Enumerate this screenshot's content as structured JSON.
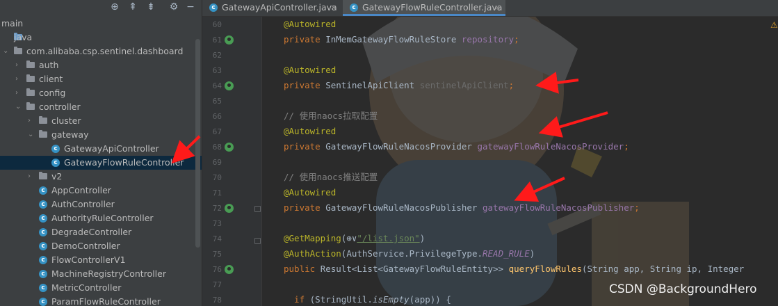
{
  "project": {
    "tree": [
      {
        "label": "main",
        "indent": 0,
        "type": "none",
        "arrow": ""
      },
      {
        "label": "java",
        "indent": 1,
        "type": "src",
        "arrow": ""
      },
      {
        "label": "com.alibaba.csp.sentinel.dashboard",
        "indent": 1,
        "type": "folder",
        "arrow": "v"
      },
      {
        "label": "auth",
        "indent": 2,
        "type": "folder",
        "arrow": ">"
      },
      {
        "label": "client",
        "indent": 2,
        "type": "folder",
        "arrow": ">"
      },
      {
        "label": "config",
        "indent": 2,
        "type": "folder",
        "arrow": ">"
      },
      {
        "label": "controller",
        "indent": 2,
        "type": "folder",
        "arrow": "v"
      },
      {
        "label": "cluster",
        "indent": 3,
        "type": "folder",
        "arrow": ">"
      },
      {
        "label": "gateway",
        "indent": 3,
        "type": "folder",
        "arrow": "v"
      },
      {
        "label": "GatewayApiController",
        "indent": 4,
        "type": "class",
        "arrow": ""
      },
      {
        "label": "GatewayFlowRuleController",
        "indent": 4,
        "type": "class",
        "arrow": "",
        "selected": true
      },
      {
        "label": "v2",
        "indent": 3,
        "type": "folder",
        "arrow": ">"
      },
      {
        "label": "AppController",
        "indent": 3,
        "type": "class",
        "arrow": ""
      },
      {
        "label": "AuthController",
        "indent": 3,
        "type": "class",
        "arrow": ""
      },
      {
        "label": "AuthorityRuleController",
        "indent": 3,
        "type": "class",
        "arrow": ""
      },
      {
        "label": "DegradeController",
        "indent": 3,
        "type": "class",
        "arrow": ""
      },
      {
        "label": "DemoController",
        "indent": 3,
        "type": "class",
        "arrow": ""
      },
      {
        "label": "FlowControllerV1",
        "indent": 3,
        "type": "class",
        "arrow": ""
      },
      {
        "label": "MachineRegistryController",
        "indent": 3,
        "type": "class",
        "arrow": ""
      },
      {
        "label": "MetricController",
        "indent": 3,
        "type": "class",
        "arrow": ""
      },
      {
        "label": "ParamFlowRuleController",
        "indent": 3,
        "type": "class",
        "arrow": ""
      }
    ]
  },
  "tabs": [
    {
      "label": "GatewayApiController.java",
      "active": false
    },
    {
      "label": "GatewayFlowRuleController.java",
      "active": true
    }
  ],
  "tab_close_glyph": "×",
  "class_icon_letter": "c",
  "editor": {
    "lines": [
      {
        "num": "60",
        "tokens": [
          [
            "ann",
            "@Autowired"
          ]
        ]
      },
      {
        "num": "61",
        "gutter": true,
        "tokens": [
          [
            "kw",
            "private "
          ],
          [
            "",
            "InMemGatewayFlowRuleStore "
          ],
          [
            "fld",
            "repository"
          ],
          [
            "kw",
            ";"
          ]
        ]
      },
      {
        "num": "62",
        "tokens": []
      },
      {
        "num": "63",
        "tokens": [
          [
            "ann",
            "@Autowired"
          ]
        ]
      },
      {
        "num": "64",
        "gutter": true,
        "tokens": [
          [
            "kw",
            "private "
          ],
          [
            "",
            "SentinelApiClient "
          ],
          [
            "fld-dim",
            "sentinelApiClient"
          ],
          [
            "kw",
            ";"
          ]
        ]
      },
      {
        "num": "65",
        "tokens": []
      },
      {
        "num": "66",
        "tokens": [
          [
            "cmt",
            "// 使用naocs拉取配置"
          ]
        ]
      },
      {
        "num": "67",
        "tokens": [
          [
            "ann",
            "@Autowired"
          ]
        ]
      },
      {
        "num": "68",
        "gutter": true,
        "tokens": [
          [
            "kw",
            "private "
          ],
          [
            "",
            "GatewayFlowRuleNacosProvider "
          ],
          [
            "fld",
            "gatewayFlowRuleNacosProvider"
          ],
          [
            "kw",
            ";"
          ]
        ]
      },
      {
        "num": "69",
        "tokens": []
      },
      {
        "num": "70",
        "tokens": [
          [
            "cmt",
            "// 使用naocs推送配置"
          ]
        ]
      },
      {
        "num": "71",
        "tokens": [
          [
            "ann",
            "@Autowired"
          ]
        ]
      },
      {
        "num": "72",
        "gutter": true,
        "tokens": [
          [
            "kw",
            "private "
          ],
          [
            "",
            "GatewayFlowRuleNacosPublisher "
          ],
          [
            "fld",
            "gatewayFlowRuleNacosPublisher"
          ],
          [
            "kw",
            ";"
          ]
        ]
      },
      {
        "num": "73",
        "tokens": []
      },
      {
        "num": "74",
        "tokens": [
          [
            "ann",
            "@GetMapping"
          ],
          [
            "",
            "(⊕∨"
          ],
          [
            "str",
            "\"/list.json\""
          ],
          [
            "",
            ")"
          ]
        ]
      },
      {
        "num": "75",
        "tokens": [
          [
            "ann",
            "@AuthAction"
          ],
          [
            "",
            "(AuthService.PrivilegeType."
          ],
          [
            "fld italic",
            "READ_RULE"
          ],
          [
            "",
            ")"
          ]
        ]
      },
      {
        "num": "76",
        "gutter": true,
        "tokens": [
          [
            "kw",
            "public "
          ],
          [
            "",
            "Result<List<GatewayFlowRuleEntity>> "
          ],
          [
            "fn",
            "queryFlowRules"
          ],
          [
            "",
            "(String app, String ip, Integer"
          ]
        ]
      },
      {
        "num": "77",
        "tokens": []
      },
      {
        "num": "78",
        "tokens": [
          [
            "kw",
            "  if "
          ],
          [
            "",
            "(StringUtil."
          ],
          [
            "italic",
            "isEmpty"
          ],
          [
            "",
            "(app)) {"
          ]
        ]
      }
    ]
  },
  "watermark": "CSDN @BackgroundHero",
  "colors": {
    "annotation": "#bbb529",
    "keyword": "#cc7832",
    "field": "#9876aa",
    "comment": "#808080",
    "arrow": "#ff1a1a"
  }
}
